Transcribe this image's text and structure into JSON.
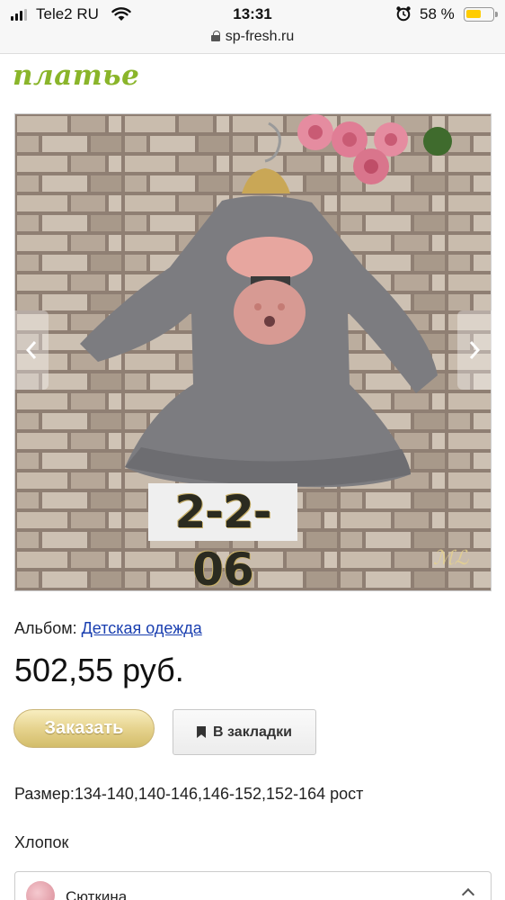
{
  "status_bar": {
    "carrier": "Tele2 RU",
    "time": "13:31",
    "battery_percent": "58 %",
    "battery_level": 0.58,
    "signal_bars": 3,
    "signal_total": 4
  },
  "browser": {
    "url": "sp-fresh.ru"
  },
  "page": {
    "title": "платье",
    "photo_code": "2-2-06",
    "album_label": "Альбом:",
    "album_link": "Детская одежда",
    "price": "502,55 руб.",
    "order_label": "Заказать",
    "bookmark_label": "В закладки",
    "size": "Размер:134-140,140-146,146-152,152-164 рост",
    "material": "Хлопок"
  },
  "seller": {
    "name": "Сюткина"
  },
  "colors": {
    "title_green": "#8ab52a",
    "link_blue": "#1a3fb0",
    "order_gold": "#e6d38e"
  },
  "icons": [
    "signal-icon",
    "wifi-icon",
    "alarm-icon",
    "battery-icon",
    "lock-icon",
    "chevron-left-icon",
    "chevron-right-icon",
    "bookmark-icon",
    "chevron-up-icon"
  ]
}
